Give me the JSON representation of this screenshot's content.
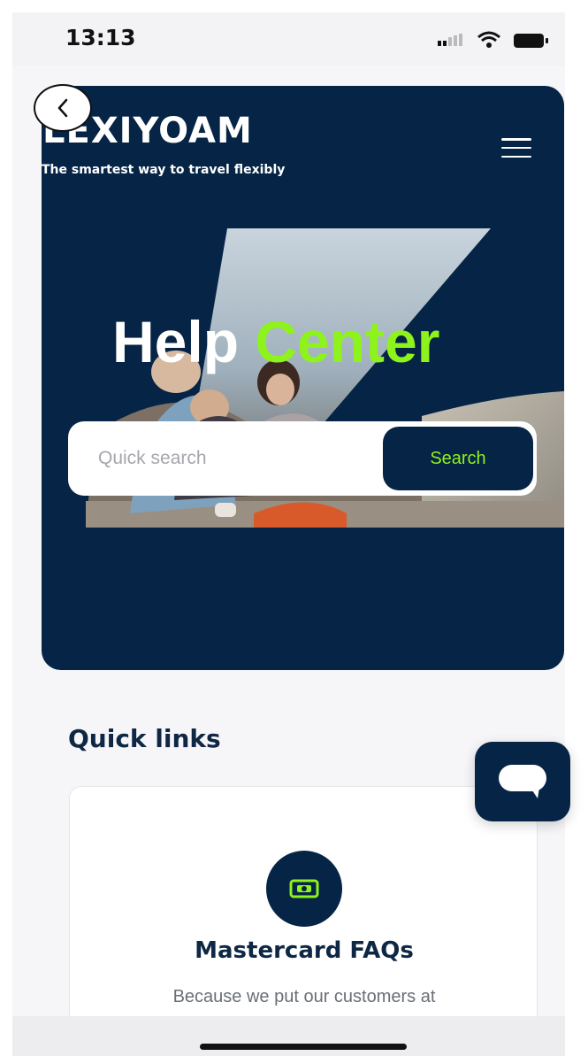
{
  "status_bar": {
    "time": "13:13",
    "icons": [
      "signal-icon",
      "wifi-icon",
      "battery-icon"
    ]
  },
  "header": {
    "back_icon": "chevron-left-icon",
    "logo_text": "LEXIYOAM",
    "tagline": "The smartest way to travel flexibly",
    "menu_icon": "hamburger-menu-icon"
  },
  "hero": {
    "title_part1": "Help",
    "title_part2": "Center",
    "search_placeholder": "Quick search",
    "search_button": "Search"
  },
  "quick_links": {
    "heading": "Quick links",
    "cards": [
      {
        "icon": "card-icon",
        "title": "Mastercard FAQs",
        "description": "Because we put our customers at"
      }
    ]
  },
  "chat": {
    "icon": "chat-bubble-icon"
  },
  "colors": {
    "navy": "#062445",
    "accent_green": "#8ef21c",
    "heading_text": "#0e2744",
    "muted_text": "#6a6f77"
  }
}
